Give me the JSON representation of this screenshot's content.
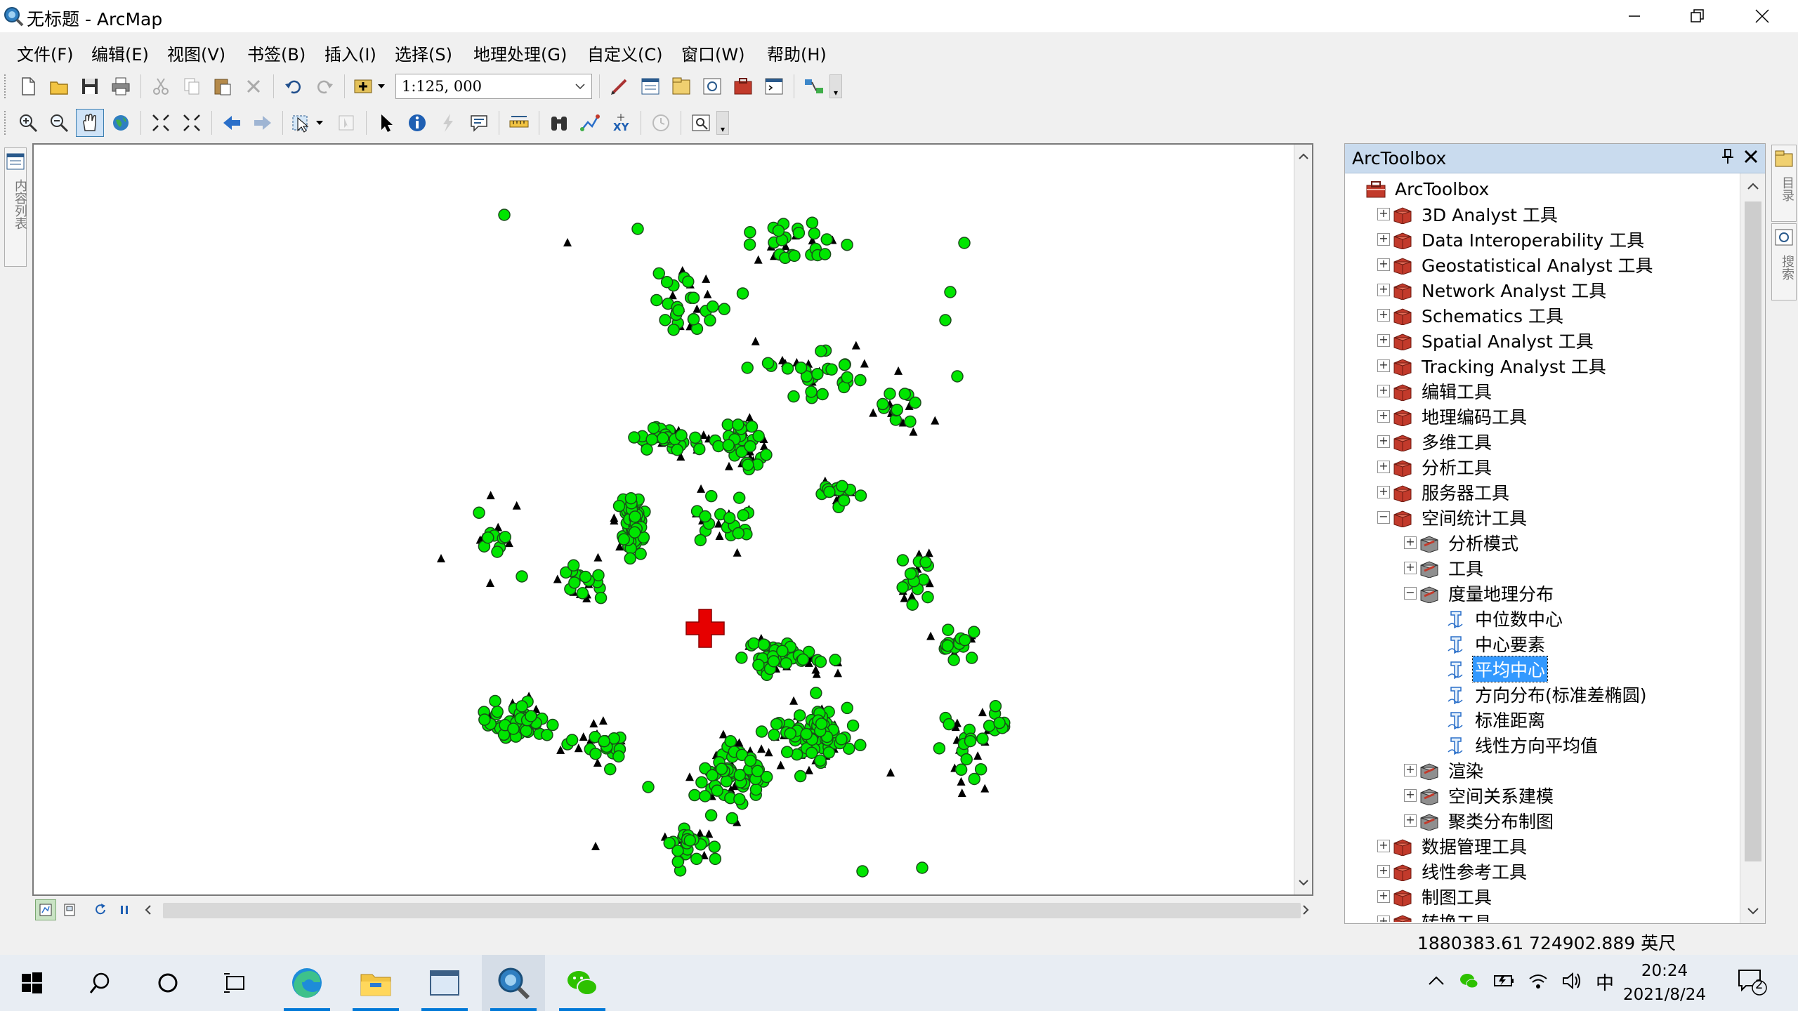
{
  "window": {
    "title": "无标题 - ArcMap"
  },
  "menu": {
    "items": [
      "文件(F)",
      "编辑(E)",
      "视图(V)",
      "书签(B)",
      "插入(I)",
      "选择(S)",
      "地理处理(G)",
      "自定义(C)",
      "窗口(W)",
      "帮助(H)"
    ]
  },
  "standard_toolbar": {
    "scale_value": "1:125, 000"
  },
  "left_dock": {
    "label": "内容列表"
  },
  "right_dock": {
    "tab1_label": "目录",
    "tab2_label": "搜索"
  },
  "toolbox": {
    "title": "ArcToolbox",
    "items": [
      {
        "label": "ArcToolbox",
        "level": 0,
        "type": "root",
        "expander": ""
      },
      {
        "label": "3D Analyst 工具",
        "level": 1,
        "type": "toolbox",
        "expander": "+"
      },
      {
        "label": "Data Interoperability 工具",
        "level": 1,
        "type": "toolbox",
        "expander": "+"
      },
      {
        "label": "Geostatistical Analyst 工具",
        "level": 1,
        "type": "toolbox",
        "expander": "+"
      },
      {
        "label": "Network Analyst 工具",
        "level": 1,
        "type": "toolbox",
        "expander": "+"
      },
      {
        "label": "Schematics 工具",
        "level": 1,
        "type": "toolbox",
        "expander": "+"
      },
      {
        "label": "Spatial Analyst 工具",
        "level": 1,
        "type": "toolbox",
        "expander": "+"
      },
      {
        "label": "Tracking Analyst 工具",
        "level": 1,
        "type": "toolbox",
        "expander": "+"
      },
      {
        "label": "编辑工具",
        "level": 1,
        "type": "toolbox",
        "expander": "+"
      },
      {
        "label": "地理编码工具",
        "level": 1,
        "type": "toolbox",
        "expander": "+"
      },
      {
        "label": "多维工具",
        "level": 1,
        "type": "toolbox",
        "expander": "+"
      },
      {
        "label": "分析工具",
        "level": 1,
        "type": "toolbox",
        "expander": "+"
      },
      {
        "label": "服务器工具",
        "level": 1,
        "type": "toolbox",
        "expander": "+"
      },
      {
        "label": "空间统计工具",
        "level": 1,
        "type": "toolbox",
        "expander": "−"
      },
      {
        "label": "分析模式",
        "level": 2,
        "type": "toolset",
        "expander": "+"
      },
      {
        "label": "工具",
        "level": 2,
        "type": "toolset",
        "expander": "+"
      },
      {
        "label": "度量地理分布",
        "level": 2,
        "type": "toolset",
        "expander": "−"
      },
      {
        "label": "中位数中心",
        "level": 3,
        "type": "tool",
        "expander": ""
      },
      {
        "label": "中心要素",
        "level": 3,
        "type": "tool",
        "expander": ""
      },
      {
        "label": "平均中心",
        "level": 3,
        "type": "tool",
        "expander": "",
        "selected": true
      },
      {
        "label": "方向分布(标准差椭圆)",
        "level": 3,
        "type": "tool",
        "expander": ""
      },
      {
        "label": "标准距离",
        "level": 3,
        "type": "tool",
        "expander": ""
      },
      {
        "label": "线性方向平均值",
        "level": 3,
        "type": "tool",
        "expander": ""
      },
      {
        "label": "渲染",
        "level": 2,
        "type": "toolset",
        "expander": "+"
      },
      {
        "label": "空间关系建模",
        "level": 2,
        "type": "toolset",
        "expander": "+"
      },
      {
        "label": "聚类分布制图",
        "level": 2,
        "type": "toolset",
        "expander": "+"
      },
      {
        "label": "数据管理工具",
        "level": 1,
        "type": "toolbox",
        "expander": "+"
      },
      {
        "label": "线性参考工具",
        "level": 1,
        "type": "toolbox",
        "expander": "+"
      },
      {
        "label": "制图工具",
        "level": 1,
        "type": "toolbox",
        "expander": "+"
      },
      {
        "label": "转换工具",
        "level": 1,
        "type": "toolbox",
        "expander": "+"
      }
    ]
  },
  "status": {
    "coordinates": "1880383.61  724902.889 英尺"
  },
  "taskbar": {
    "time": "20:24",
    "date": "2021/8/24",
    "ime": "中",
    "notification_count": "2"
  },
  "colors": {
    "point_fill": "#00e600",
    "triangle_fill": "#000000",
    "mean_center": "#e60000",
    "selection": "#3399ff",
    "panel_header": "#c9dbee"
  }
}
